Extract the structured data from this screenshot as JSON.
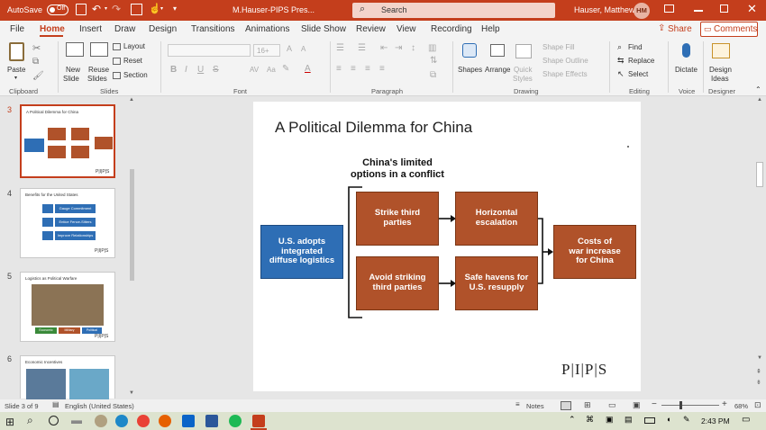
{
  "titlebar": {
    "autosave": "AutoSave",
    "toggle": "Off",
    "doc_title": "M.Hauser-PIPS Pres...",
    "search_placeholder": "Search",
    "user": "Hauser, Matthew",
    "initials": "HM"
  },
  "tabs": [
    "File",
    "Home",
    "Insert",
    "Draw",
    "Design",
    "Transitions",
    "Animations",
    "Slide Show",
    "Review",
    "View",
    "Recording",
    "Help"
  ],
  "share": "Share",
  "comments": "Comments",
  "ribbon": {
    "paste": "Paste",
    "new_slide": [
      "New",
      "Slide"
    ],
    "reuse_slides": [
      "Reuse",
      "Slides"
    ],
    "layout": "Layout",
    "reset": "Reset",
    "section": "Section",
    "font_size": "16+",
    "shapes": "Shapes",
    "arrange": "Arrange",
    "quick_styles": [
      "Quick",
      "Styles"
    ],
    "shape_fill": "Shape Fill",
    "shape_outline": "Shape Outline",
    "shape_effects": "Shape Effects",
    "find": "Find",
    "replace": "Replace",
    "select": "Select",
    "dictate": "Dictate",
    "design_ideas": [
      "Design",
      "Ideas"
    ],
    "groups": [
      "Clipboard",
      "Slides",
      "Font",
      "Paragraph",
      "Drawing",
      "Editing",
      "Voice",
      "Designer"
    ]
  },
  "thumbs": [
    {
      "num": "3",
      "title": "A Political Dilemma for China"
    },
    {
      "num": "4",
      "title": "Benefits for the United States",
      "items": [
        "Gauge Commitment",
        "Entice Fence-Sitters",
        "Improve Relationships"
      ]
    },
    {
      "num": "5",
      "title": "Logistics as Political Warfare",
      "tags": [
        "Economic",
        "Military",
        "Political"
      ]
    },
    {
      "num": "6",
      "title": "Economic Incentives"
    }
  ],
  "thumb_logo": "P|I|P|S",
  "slide": {
    "title": "A Political Dilemma for China",
    "options_header": "China's limited\noptions in a conflict",
    "us_box": "U.S. adopts\nintegrated\ndiffuse logistics",
    "strike": "Strike third\nparties",
    "avoid": "Avoid striking\nthird parties",
    "horizontal": "Horizontal\nescalation",
    "safe": "Safe havens for\nU.S. resupply",
    "costs": "Costs of\nwar increase\nfor China",
    "logo": "P|I|P|S"
  },
  "colors": {
    "accent": "#c43e1c",
    "box_orange": "#b0522a",
    "box_blue": "#2e6eb5"
  },
  "status": {
    "slide": "Slide 3 of 9",
    "language": "English (United States)",
    "notes": "Notes",
    "zoom": "68%"
  },
  "taskbar": {
    "time": "2:43 PM"
  }
}
